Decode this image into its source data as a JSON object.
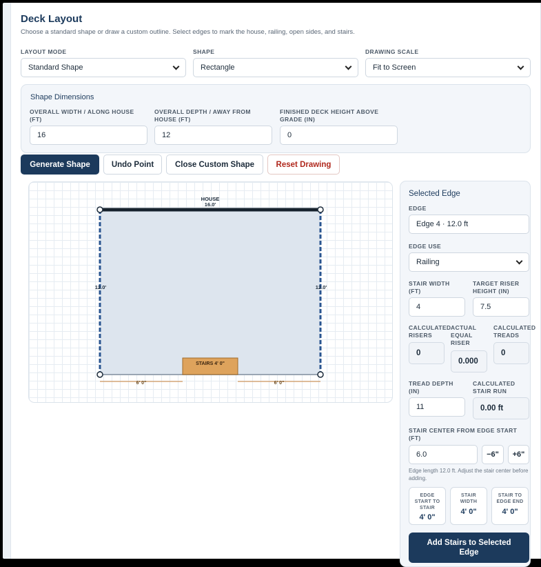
{
  "header": {
    "title": "Deck Layout",
    "subtitle": "Choose a standard shape or draw a custom outline. Select edges to mark the house, railing, open sides, and stairs."
  },
  "controls": {
    "layout_mode_label": "LAYOUT MODE",
    "layout_mode_value": "Standard Shape",
    "shape_label": "SHAPE",
    "shape_value": "Rectangle",
    "scale_label": "DRAWING SCALE",
    "scale_value": "Fit to Screen"
  },
  "dimensions": {
    "title": "Shape Dimensions",
    "width_label_1": "OVERALL WIDTH / ALONG HOUSE",
    "width_label_2": "(FT)",
    "width_value": "16",
    "depth_label_1": "OVERALL DEPTH / AWAY FROM",
    "depth_label_2": "HOUSE (FT)",
    "depth_value": "12",
    "height_label_1": "FINISHED DECK HEIGHT ABOVE",
    "height_label_2": "GRADE (IN)",
    "height_value": "0"
  },
  "actions": {
    "generate": "Generate Shape",
    "undo": "Undo Point",
    "close": "Close Custom Shape",
    "reset": "Reset Drawing"
  },
  "drawing": {
    "house_label": "HOUSE",
    "house_length": "16.0'",
    "left_length": "12.0'",
    "right_length": "12.0'",
    "stairs_label": "STAIRS 4' 0\"",
    "left_gap": "6' 0\"",
    "right_gap": "6' 0\""
  },
  "edge_panel": {
    "title": "Selected Edge",
    "edge_label": "EDGE",
    "edge_value": "Edge 4 · 12.0 ft",
    "use_label": "EDGE USE",
    "use_value": "Railing",
    "stair_width_label_1": "STAIR WIDTH",
    "stair_width_label_2": "(FT)",
    "stair_width_value": "4",
    "riser_label_1": "TARGET RISER",
    "riser_label_2": "HEIGHT (IN)",
    "riser_value": "7.5",
    "calc_risers_label_1": "CALCULATED",
    "calc_risers_label_2": "RISERS",
    "calc_risers_value": "0",
    "equal_riser_label_1": "ACTUAL",
    "equal_riser_label_2": "EQUAL",
    "equal_riser_label_3": "RISER",
    "equal_riser_value": "0.000",
    "calc_treads_label_1": "CALCULATED",
    "calc_treads_label_2": "TREADS",
    "calc_treads_value": "0",
    "tread_label_1": "TREAD DEPTH",
    "tread_label_2": "(IN)",
    "tread_value": "11",
    "run_label_1": "CALCULATED",
    "run_label_2": "STAIR RUN",
    "run_value": "0.00 ft",
    "center_label_1": "STAIR CENTER FROM EDGE START",
    "center_label_2": "(FT)",
    "center_value": "6.0",
    "minus_label": "−6\"",
    "plus_label": "+6\"",
    "note_1": "Edge length 12.0 ft. Adjust the stair center before",
    "note_2": "adding.",
    "stat_start_1": "EDGE",
    "stat_start_2": "START TO",
    "stat_start_3": "STAIR",
    "stat_start_value": "4' 0\"",
    "stat_width_1": "STAIR",
    "stat_width_2": "WIDTH",
    "stat_width_value": "4' 0\"",
    "stat_end_1": "STAIR TO",
    "stat_end_2": "EDGE END",
    "stat_end_value": "4' 0\"",
    "add_stairs_1": "Add Stairs to Selected",
    "add_stairs_2": "Edge"
  },
  "colors": {
    "primary": "#1c3a5c",
    "danger": "#b0281d",
    "deck_fill": "#dde5ee",
    "stairs_fill": "#dea35c",
    "railing": "#2a5590"
  }
}
